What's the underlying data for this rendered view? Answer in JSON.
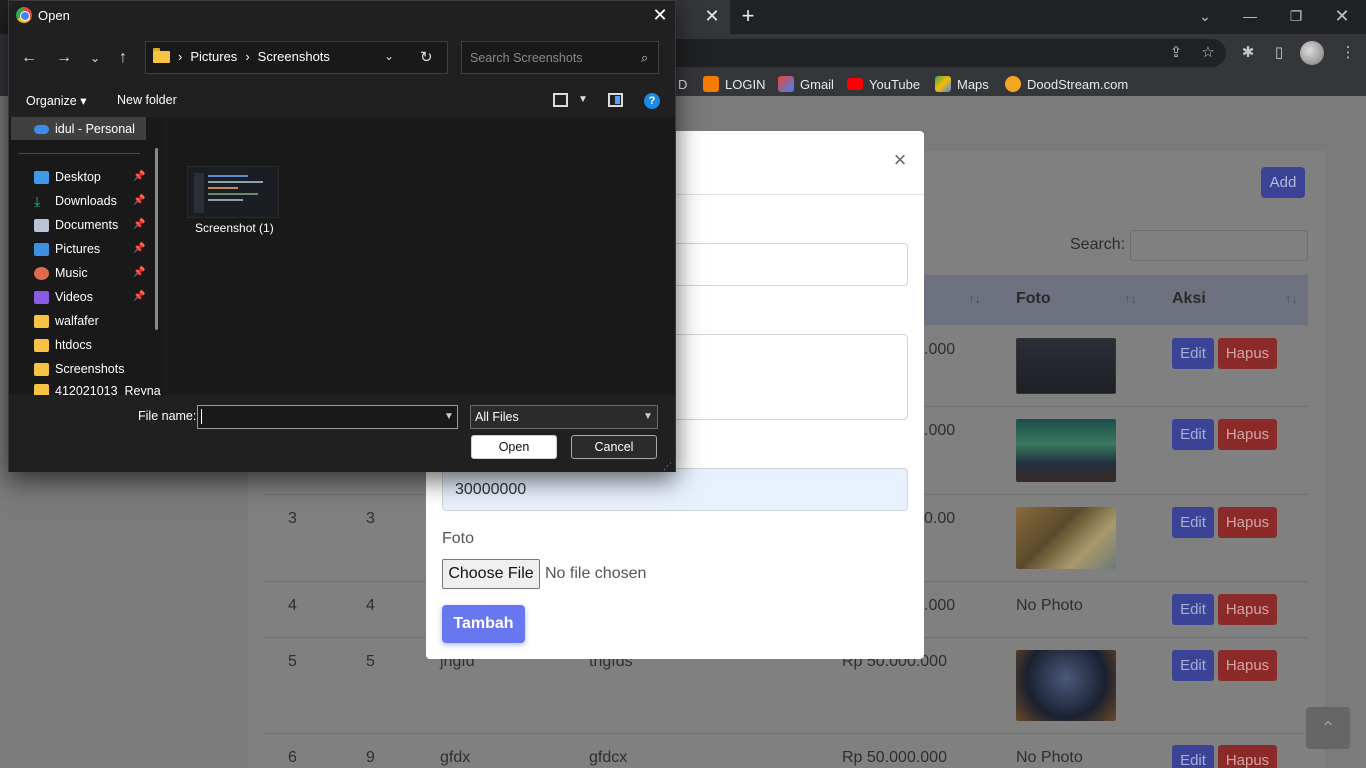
{
  "browser": {
    "bookmarks": [
      {
        "label": "D"
      },
      {
        "label": "LOGIN",
        "color": "#f57c00"
      },
      {
        "label": "Gmail",
        "color": "#ea4335"
      },
      {
        "label": "YouTube",
        "color": "#ff0000"
      },
      {
        "label": "Maps",
        "color": "#34a853"
      },
      {
        "label": "DoodStream.com",
        "color": "#f5a623"
      }
    ]
  },
  "page": {
    "add_label": "Add",
    "search_label": "Search:",
    "columns": [
      "Foto",
      "Aksi"
    ],
    "rows": [
      {
        "price_frag": ".000",
        "foto": "thumb"
      },
      {
        "price_frag": ".000",
        "foto": "thumb"
      },
      {
        "no": "3",
        "id": "3",
        "price_frag": "0.00",
        "foto": "thumb"
      },
      {
        "no": "4",
        "id": "4",
        "price_frag": ".000",
        "foto": "No Photo"
      },
      {
        "no": "5",
        "id": "5",
        "name": "jhgfd",
        "desc": "thgfds",
        "price": "Rp 50.000.000",
        "foto": "thumb"
      },
      {
        "no": "6",
        "id": "9",
        "name": "gfdx",
        "desc": "gfdcx",
        "price": "Rp 50.000.000",
        "foto": "No Photo"
      }
    ],
    "edit_label": "Edit",
    "hapus_label": "Hapus",
    "no_photo": "No Photo"
  },
  "modal": {
    "close": "×",
    "price_value": "30000000",
    "foto_label": "Foto",
    "choose_file": "Choose File",
    "no_file": "No file chosen",
    "submit": "Tambah"
  },
  "dialog": {
    "title": "Open",
    "path": [
      "Pictures",
      "Screenshots"
    ],
    "search_placeholder": "Search Screenshots",
    "organize": "Organize",
    "new_folder": "New folder",
    "nav_items": [
      {
        "label": "idul - Personal",
        "icon": "onedrive-icon",
        "color": "#3b8ee8"
      },
      {
        "label": "Desktop",
        "icon": "desktop-icon",
        "color": "#3d9be9",
        "pinned": true
      },
      {
        "label": "Downloads",
        "icon": "downloads-icon",
        "color": "#37b37e",
        "pinned": true
      },
      {
        "label": "Documents",
        "icon": "documents-icon",
        "color": "#b8c4d6",
        "pinned": true
      },
      {
        "label": "Pictures",
        "icon": "pictures-icon",
        "color": "#3d8fe0",
        "pinned": true
      },
      {
        "label": "Music",
        "icon": "music-icon",
        "color": "#e06b4a",
        "pinned": true
      },
      {
        "label": "Videos",
        "icon": "videos-icon",
        "color": "#8a5ce6",
        "pinned": true
      },
      {
        "label": "walfafer",
        "icon": "folder-icon",
        "color": "#f6c343"
      },
      {
        "label": "htdocs",
        "icon": "folder-icon",
        "color": "#f6c343"
      },
      {
        "label": "Screenshots",
        "icon": "folder-icon",
        "color": "#f6c343"
      },
      {
        "label": "412021013_Reyna",
        "icon": "folder-icon",
        "color": "#f6c343"
      }
    ],
    "file": {
      "label": "Screenshot (1)"
    },
    "file_name_label": "File name:",
    "file_name_value": "",
    "file_type": "All Files",
    "open_btn": "Open",
    "cancel_btn": "Cancel"
  }
}
